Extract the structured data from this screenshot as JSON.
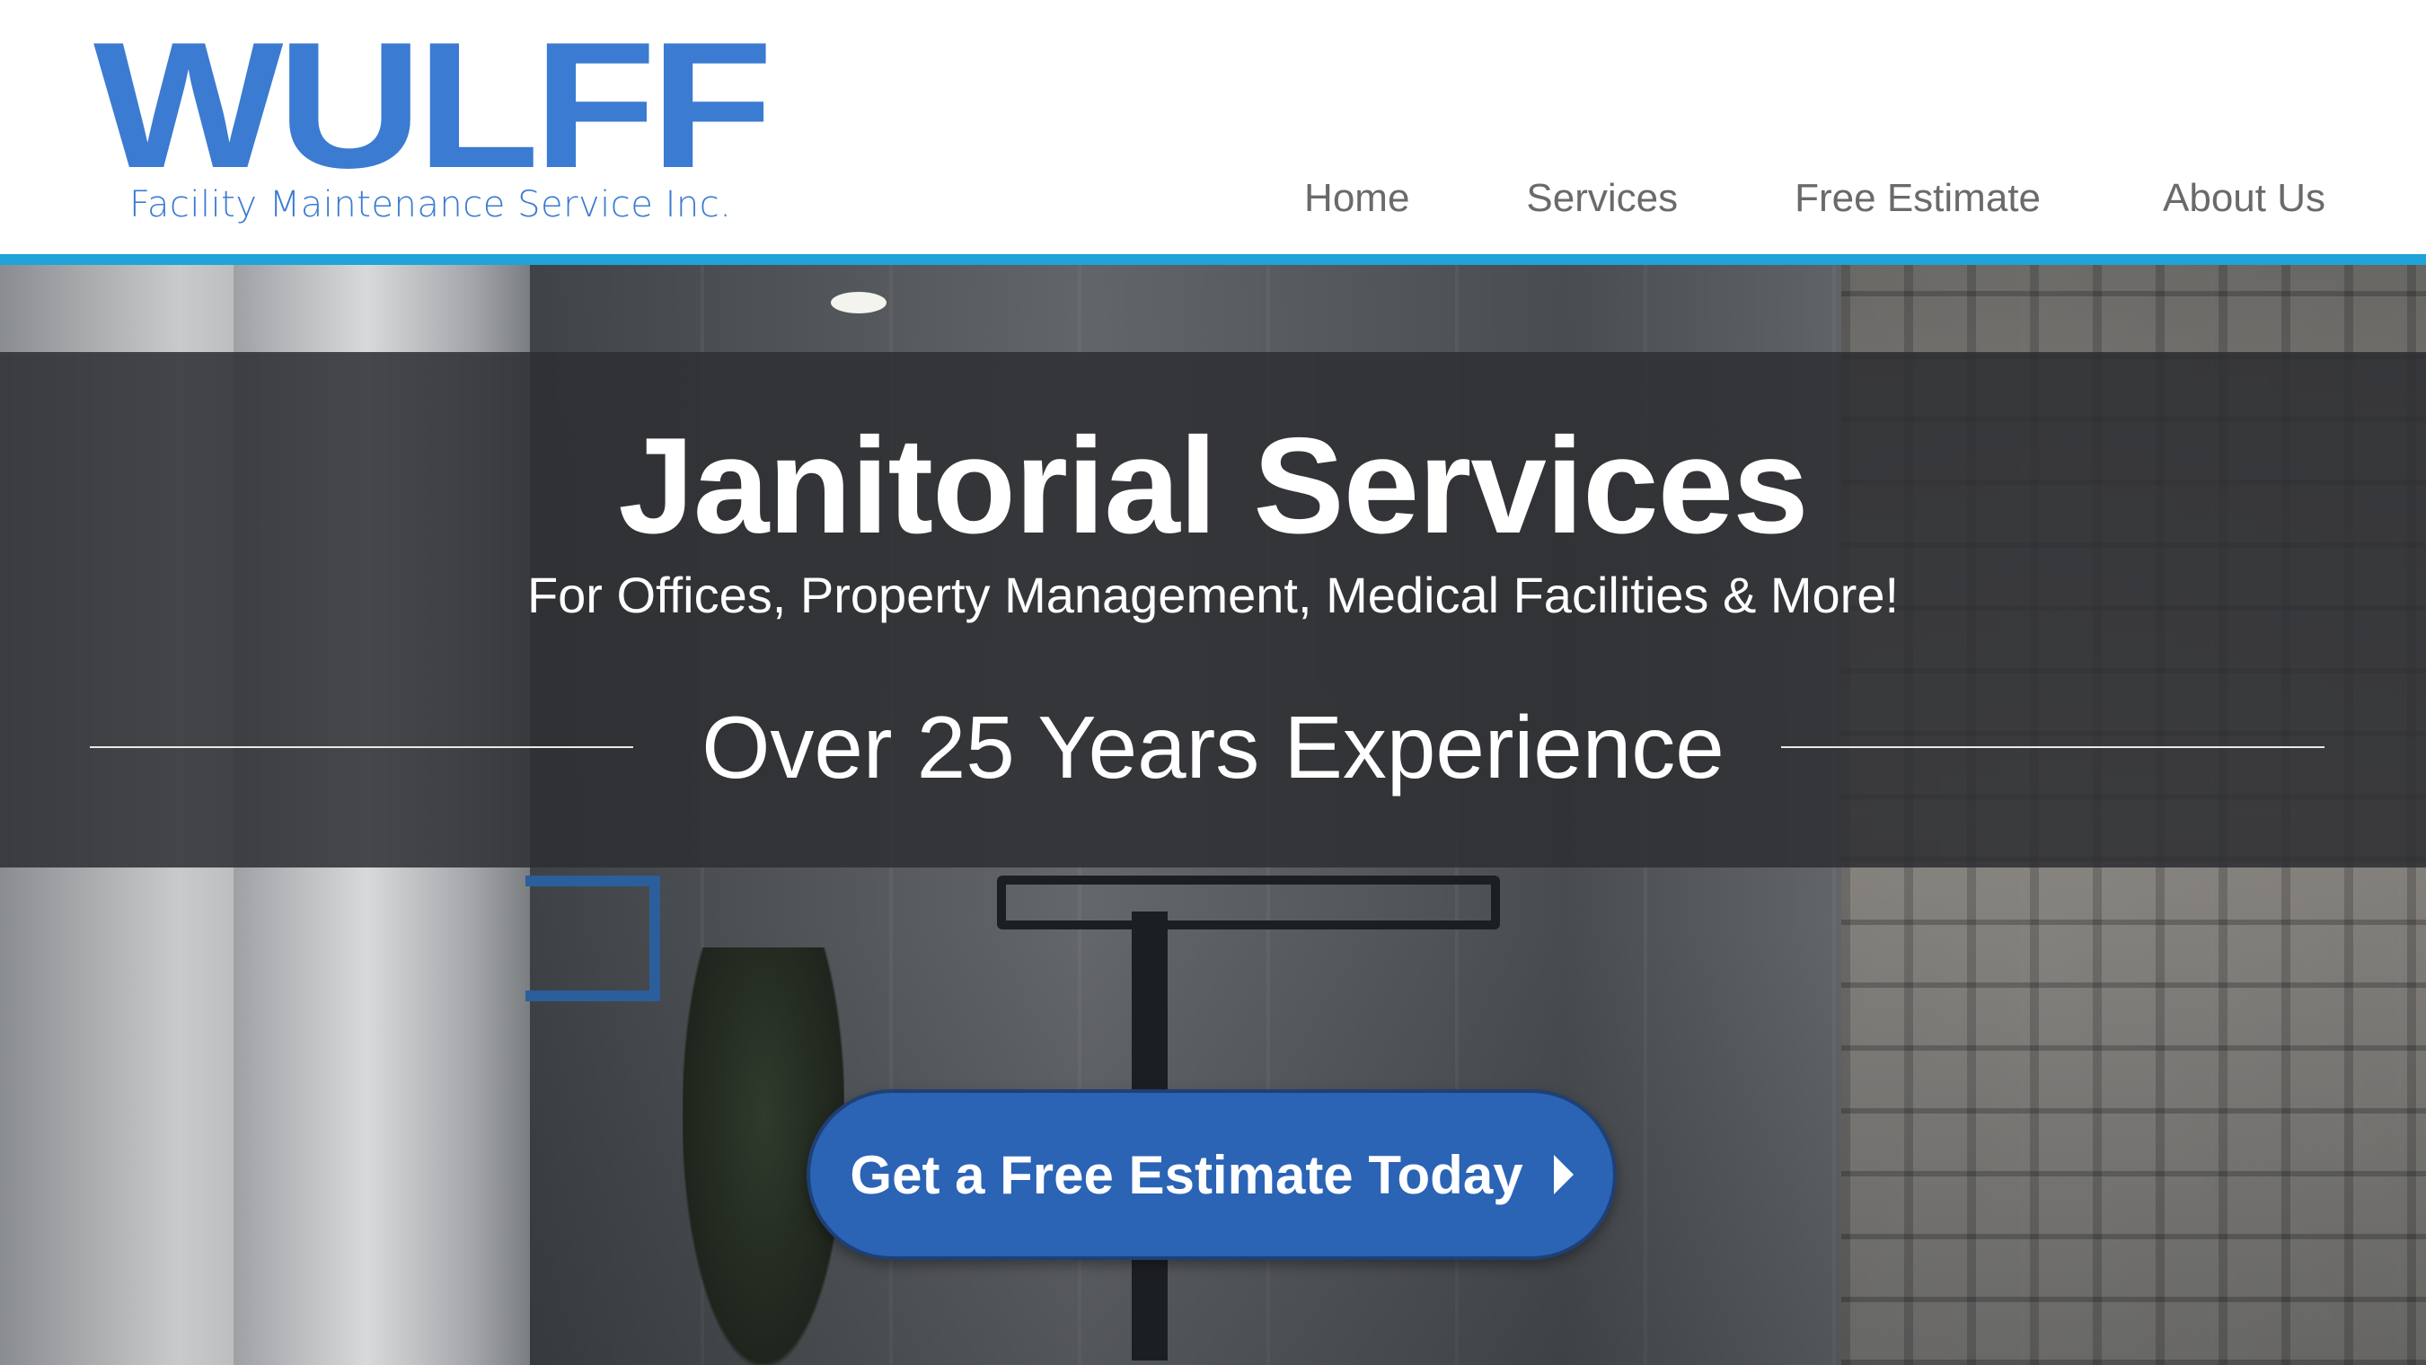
{
  "brand": {
    "name": "WULFF",
    "tagline": "Facility Maintenance Service Inc.",
    "color": "#3b7bd1"
  },
  "nav": {
    "items": [
      {
        "label": "Home"
      },
      {
        "label": "Services"
      },
      {
        "label": "Free Estimate"
      },
      {
        "label": "About Us"
      }
    ]
  },
  "theme": {
    "accent_bar_color": "#1fa3d8",
    "cta_color": "#2b63b5"
  },
  "hero": {
    "title": "Janitorial Services",
    "subtitle": "For Offices, Property Management, Medical Facilities & More!",
    "experience": "Over 25 Years Experience",
    "cta_label": "Get a Free Estimate Today",
    "cta_icon": "chevron-right-icon"
  }
}
